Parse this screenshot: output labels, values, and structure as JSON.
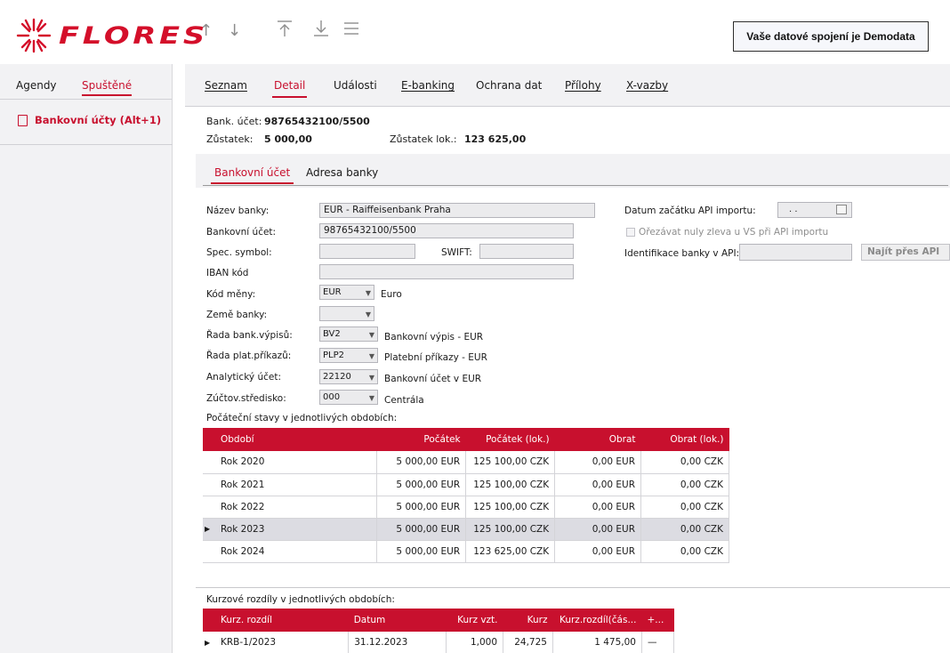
{
  "app": {
    "logo_text": "FLORES",
    "status": "Vaše datové spojení je Demodata"
  },
  "nav_icons": [
    "arrow-up-icon",
    "arrow-down-icon",
    "arrow-to-top-icon",
    "arrow-to-bottom-icon",
    "menu-icon"
  ],
  "sidebar": {
    "tabs": [
      "Agendy",
      "Spuštěné"
    ],
    "item": "Bankovní účty (Alt+1)"
  },
  "main_tabs": [
    "Seznam",
    "Detail",
    "Události",
    "E-banking",
    "Ochrana dat",
    "Přílohy",
    "X-vazby"
  ],
  "account": {
    "account_label": "Bank. účet:",
    "account_value": "98765432100/5500",
    "balance_label": "Zůstatek:",
    "balance_value": "5 000,00",
    "local_balance_label": "Zůstatek lok.:",
    "local_balance_value": "123 625,00"
  },
  "sub_tabs": [
    "Bankovní účet",
    "Adresa banky"
  ],
  "form": {
    "bank_name_label": "Název banky:",
    "bank_name_value": "EUR - Raiffeisenbank Praha",
    "account_label": "Bankovní účet:",
    "account_value": "98765432100/5500",
    "spec_symbol_label": "Spec. symbol:",
    "spec_symbol_value": "",
    "swift_label": "SWIFT:",
    "swift_value": "",
    "iban_label": "IBAN kód",
    "iban_value": "",
    "currency_label": "Kód měny:",
    "currency_value": "EUR",
    "currency_note": "Euro",
    "country_label": "Země banky:",
    "country_value": "",
    "statement_series_label": "Řada bank.výpisů:",
    "statement_series_value": "BV2",
    "statement_series_note": "Bankovní výpis - EUR",
    "payment_series_label": "Řada plat.příkazů:",
    "payment_series_value": "PLP2",
    "payment_series_note": "Platební příkazy - EUR",
    "analytic_label": "Analytický účet:",
    "analytic_value": "22120",
    "analytic_note": "Bankovní účet v EUR",
    "center_label": "Zúčtov.středisko:",
    "center_value": "000",
    "center_note": "Centrála",
    "api_date_label": "Datum začátku API importu:",
    "api_date_value": ". .",
    "trim_zeros_label": "Ořezávat nuly zleva u VS při API importu",
    "api_bank_label": "Identifikace banky v API:",
    "api_bank_value": "",
    "find_api_button": "Najít přes API"
  },
  "initial_states": {
    "caption": "Počáteční stavy v jednotlivých obdobích:",
    "columns": [
      "Období",
      "Počátek",
      "Počátek (lok.)",
      "Obrat",
      "Obrat (lok.)"
    ],
    "rows": [
      {
        "period": "Rok 2020",
        "start": "5 000,00 EUR",
        "start_local": "125 100,00 CZK",
        "turnover": "0,00 EUR",
        "turnover_local": "0,00 CZK"
      },
      {
        "period": "Rok 2021",
        "start": "5 000,00 EUR",
        "start_local": "125 100,00 CZK",
        "turnover": "0,00 EUR",
        "turnover_local": "0,00 CZK"
      },
      {
        "period": "Rok 2022",
        "start": "5 000,00 EUR",
        "start_local": "125 100,00 CZK",
        "turnover": "0,00 EUR",
        "turnover_local": "0,00 CZK"
      },
      {
        "period": "Rok 2023",
        "start": "5 000,00 EUR",
        "start_local": "125 100,00 CZK",
        "turnover": "0,00 EUR",
        "turnover_local": "0,00 CZK"
      },
      {
        "period": "Rok 2024",
        "start": "5 000,00 EUR",
        "start_local": "123 625,00 CZK",
        "turnover": "0,00 EUR",
        "turnover_local": "0,00 CZK"
      }
    ],
    "selected_row": "Rok 2023"
  },
  "exchange_diffs": {
    "caption": "Kurzové rozdíly v jednotlivých obdobích:",
    "columns": [
      "Kurz. rozdíl",
      "Datum",
      "Kurz vzt.",
      "Kurz",
      "Kurz.rozdíl(čás...",
      "+..."
    ],
    "rows": [
      {
        "name": "KRB-1/2023",
        "date": "31.12.2023",
        "rate_rel": "1,000",
        "rate": "24,725",
        "diff": "1 475,00",
        "extra": "—"
      }
    ]
  }
}
